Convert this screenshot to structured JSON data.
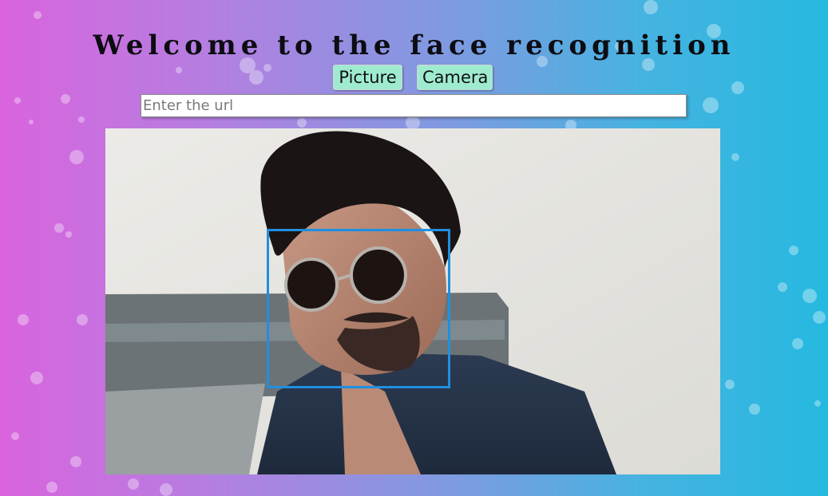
{
  "header": {
    "title": "Welcome to the face recognition"
  },
  "buttons": {
    "picture_label": "Picture",
    "camera_label": "Camera"
  },
  "url_input": {
    "placeholder": "Enter the url",
    "value": ""
  },
  "photo": {
    "alt": "Uploaded photo with detected face"
  },
  "colors": {
    "accent": "#1f8fe2",
    "button_bg": "#9eebd0",
    "gradient_left": "#d964de",
    "gradient_right": "#25b9e0"
  },
  "icons": {
    "face_detection": "face-bounding-box"
  }
}
